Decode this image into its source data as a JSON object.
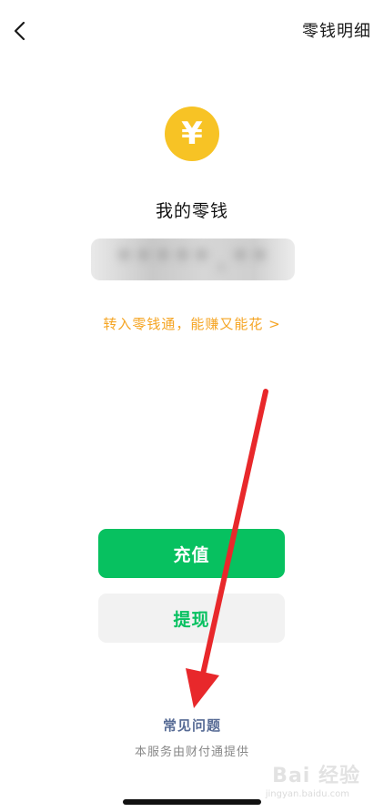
{
  "header": {
    "details_label": "零钱明细"
  },
  "wallet": {
    "coin_symbol": "¥",
    "title": "我的零钱",
    "balance_blurred": "*****.**",
    "promo_text": "转入零钱通，能赚又能花 >"
  },
  "actions": {
    "topup_label": "充值",
    "withdraw_label": "提现"
  },
  "footer": {
    "faq_label": "常见问题",
    "provider_text": "本服务由财付通提供"
  },
  "watermark": {
    "text": "Bai 经验",
    "sub": "jingyan.baidu.com"
  },
  "colors": {
    "accent_green": "#07c160",
    "coin_yellow": "#f7c325",
    "promo_orange": "#f5a524",
    "link_blue": "#576b95",
    "arrow_red": "#e8282b"
  },
  "icons": {
    "back": "back-chevron-icon",
    "coin": "yuan-coin-icon"
  }
}
